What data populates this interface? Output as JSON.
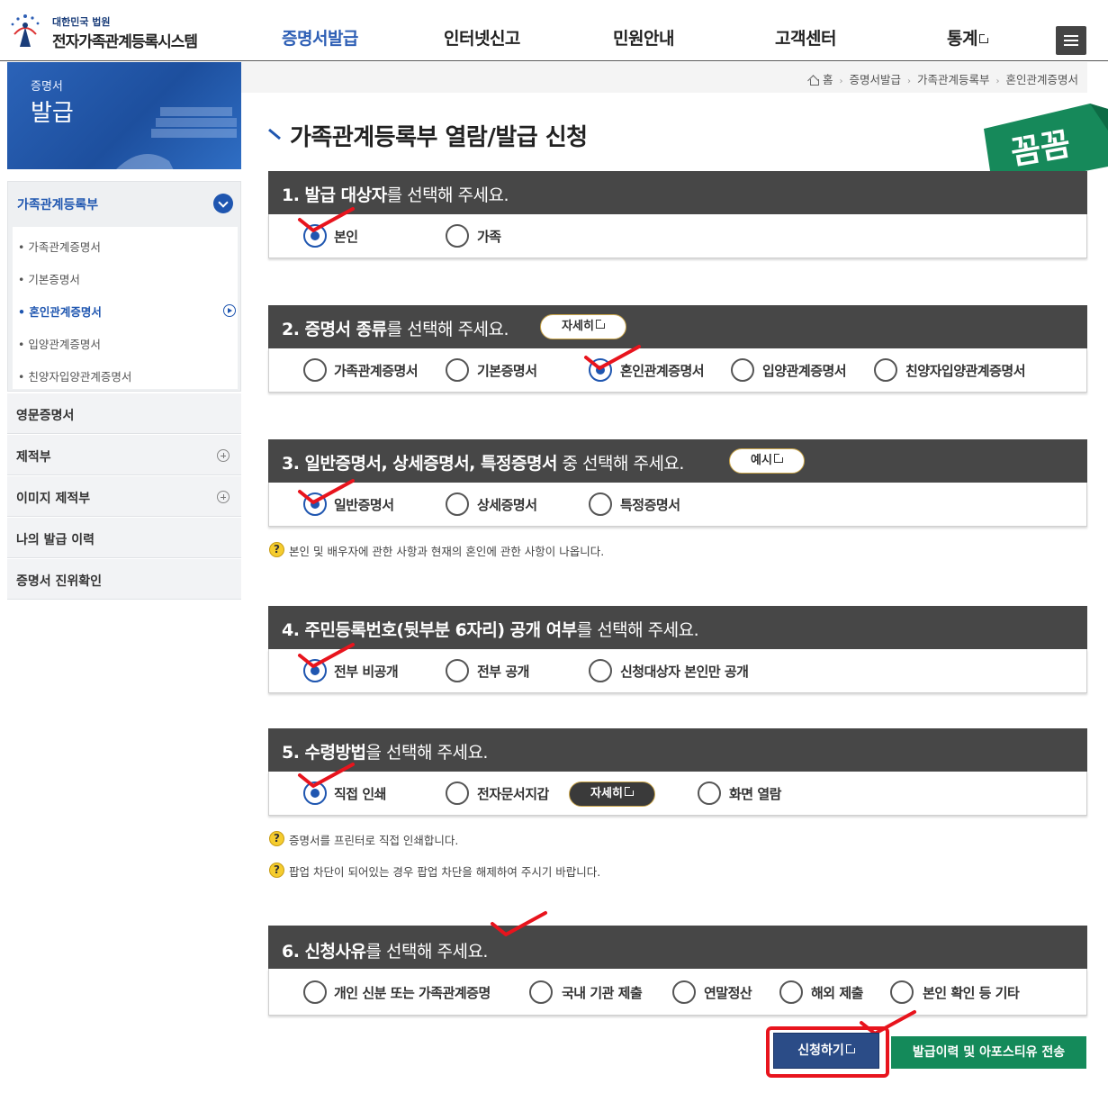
{
  "header": {
    "logo_sub": "대한민국 법원",
    "logo_main": "전자가족관계등록시스템",
    "nav": [
      "증명서발급",
      "인터넷신고",
      "민원안내",
      "고객센터",
      "통계"
    ]
  },
  "sidebar": {
    "banner_line1": "증명서",
    "banner_line2": "발급",
    "active_group": "가족관계등록부",
    "sub_items": [
      "가족관계증명서",
      "기본증명서",
      "혼인관계증명서",
      "입양관계증명서",
      "친양자입양관계증명서"
    ],
    "items": [
      "영문증명서",
      "제적부",
      "이미지 제적부",
      "나의 발급 이력",
      "증명서 진위확인"
    ]
  },
  "breadcrumb": [
    "홈",
    "증명서발급",
    "가족관계등록부",
    "혼인관계증명서"
  ],
  "page_title": "가족관계등록부 열람/발급 신청",
  "stamp_text": "꼼꼼",
  "sections": {
    "s1": {
      "bold": "1. 발급 대상자",
      "rest": "를 선택해 주세요.",
      "options": [
        "본인",
        "가족"
      ]
    },
    "s2": {
      "bold": "2. 증명서 종류",
      "rest": "를 선택해 주세요.",
      "pill": "자세히",
      "options": [
        "가족관계증명서",
        "기본증명서",
        "혼인관계증명서",
        "입양관계증명서",
        "친양자입양관계증명서"
      ]
    },
    "s3": {
      "bold": "3. 일반증명서, 상세증명서, 특정증명서",
      "rest": " 중 선택해 주세요.",
      "pill": "예시",
      "options": [
        "일반증명서",
        "상세증명서",
        "특정증명서"
      ],
      "note": "본인 및 배우자에 관한 사항과 현재의 혼인에 관한 사항이 나옵니다."
    },
    "s4": {
      "bold": "4. 주민등록번호(뒷부분 6자리) 공개 여부",
      "rest": "를 선택해 주세요.",
      "options": [
        "전부 비공개",
        "전부 공개",
        "신청대상자 본인만 공개"
      ]
    },
    "s5": {
      "bold": "5. 수령방법",
      "rest": "을 선택해 주세요.",
      "pill": "자세히",
      "options": [
        "직접 인쇄",
        "전자문서지갑",
        "화면 열람"
      ],
      "notes": [
        "증명서를 프린터로 직접 인쇄합니다.",
        "팝업 차단이 되어있는 경우 팝업 차단을 해제하여 주시기 바랍니다."
      ]
    },
    "s6": {
      "bold": "6. 신청사유",
      "rest": "를 선택해 주세요.",
      "options": [
        "개인 신분 또는 가족관계증명",
        "국내 기관 제출",
        "연말정산",
        "해외 제출",
        "본인 확인 등 기타"
      ]
    }
  },
  "question_mark": "?",
  "buttons": {
    "apply": "신청하기",
    "history": "발급이력 및 아포스티유 전송"
  },
  "colors": {
    "primary": "#1f56b0",
    "section_header": "#474747",
    "accent_green": "#148a5a",
    "highlight_red": "#e8141d"
  }
}
